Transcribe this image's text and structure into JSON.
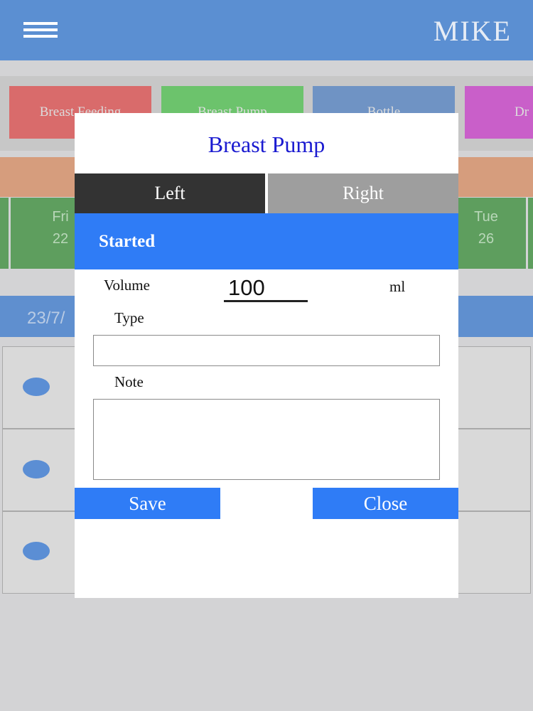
{
  "header": {
    "title": "MIKE"
  },
  "categories": [
    {
      "label": "Breast Feeding",
      "color": "#d96b6b"
    },
    {
      "label": "Breast Pump",
      "color": "#6cc36c"
    },
    {
      "label": "Bottle",
      "color": "#6f93c4"
    },
    {
      "label": "Dr",
      "color": "#c95fc9"
    }
  ],
  "days": [
    {
      "name": "Fri",
      "date": "22"
    },
    {
      "name": "Tue",
      "date": "26"
    }
  ],
  "date_bar": {
    "label": "23/7/"
  },
  "modal": {
    "title": "Breast Pump",
    "tabs": {
      "left": "Left",
      "right": "Right"
    },
    "status": "Started",
    "volume_label": "Volume",
    "volume_value": "100",
    "unit": "ml",
    "type_label": "Type",
    "type_value": "",
    "note_label": "Note",
    "note_value": "",
    "save_label": "Save",
    "close_label": "Close"
  }
}
